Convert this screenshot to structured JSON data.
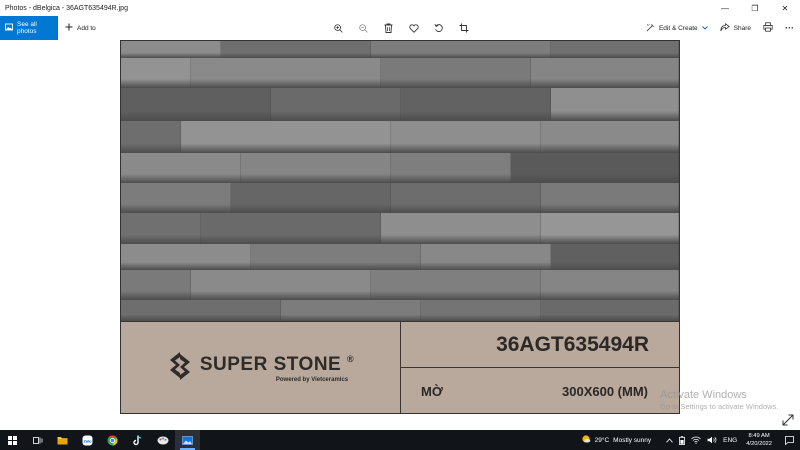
{
  "window": {
    "title": "Photos - dBelgica - 36AGT635494R.jpg",
    "minimize_glyph": "—",
    "maximize_glyph": "❐",
    "close_glyph": "✕"
  },
  "toolbar": {
    "see_all_label": "See all photos",
    "add_to_label": "Add to",
    "edit_create_label": "Edit & Create",
    "share_label": "Share",
    "more_glyph": "···",
    "icons": [
      "zoom-in-icon",
      "zoom-out-icon",
      "delete-icon",
      "heart-icon",
      "rotate-icon",
      "crop-icon"
    ]
  },
  "photo": {
    "brand": "SUPER STONE",
    "registered": "®",
    "powered_by": "Powered by Vietceramics",
    "code": "36AGT635494R",
    "finish": "MỜ",
    "size": "300X600 (MM)",
    "panel_color": "#b9a89c"
  },
  "watermark": {
    "title": "Activate Windows",
    "subtitle": "Go to Settings to activate Windows."
  },
  "taskbar": {
    "apps": [
      "start-icon",
      "task-view-icon",
      "file-explorer-icon",
      "zalo-icon",
      "chrome-icon",
      "tiktok-icon",
      "paint-icon",
      "photos-icon"
    ],
    "temperature": "29°C",
    "weather": "Mostly sunny",
    "language": "ENG",
    "time": "8:49 AM",
    "date": "4/20/2022",
    "accent": "#0078d4"
  }
}
